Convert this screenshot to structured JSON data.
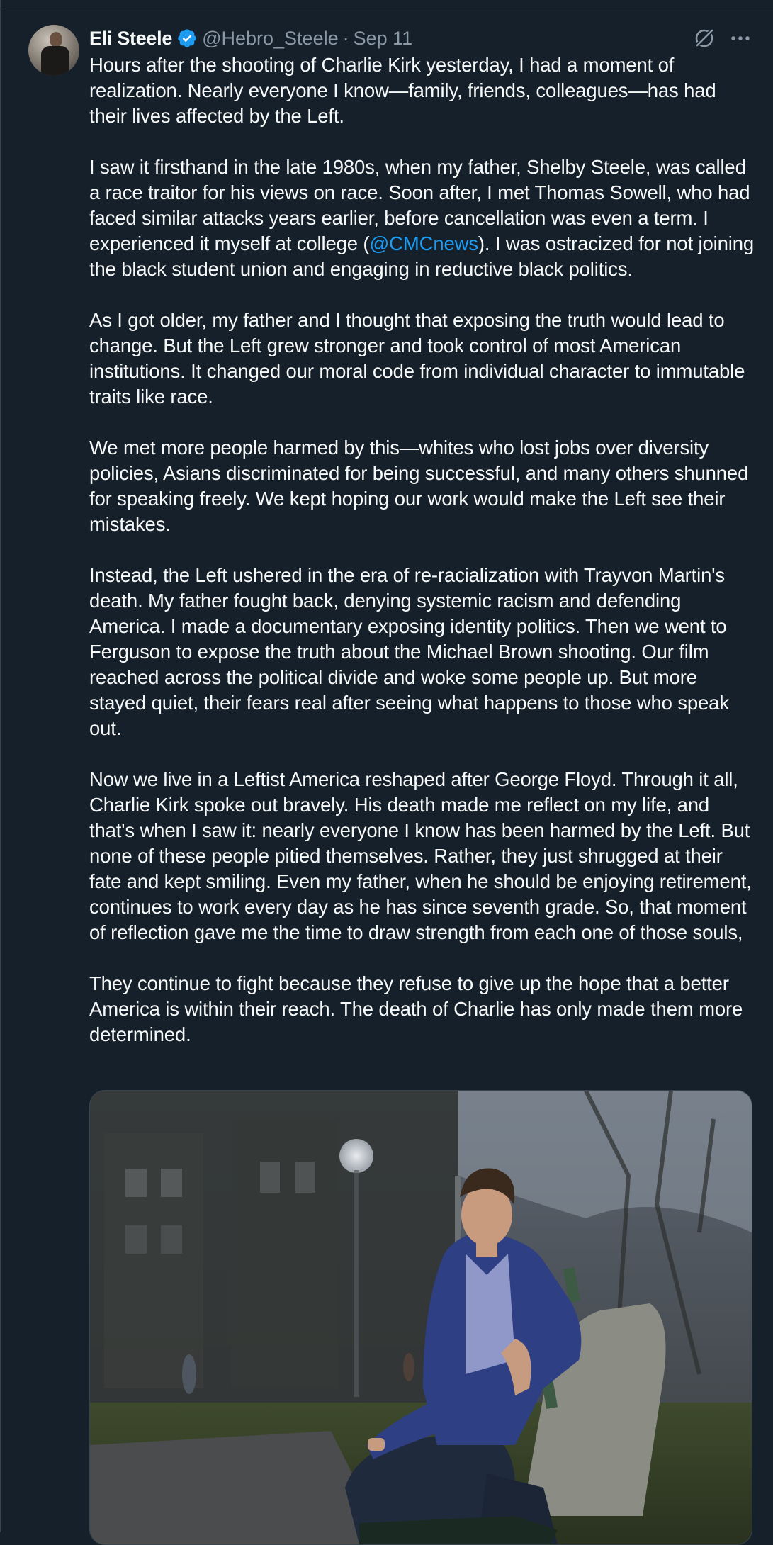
{
  "tweet": {
    "author": {
      "display_name": "Eli Steele",
      "handle": "@Hebro_Steele",
      "verified": true
    },
    "separator": "·",
    "date": "Sep 11",
    "paragraphs": [
      {
        "text": "Hours after the shooting of Charlie Kirk yesterday, I had a moment of realization. Nearly everyone I know—family, friends, colleagues—has had their lives affected by the Left."
      },
      {
        "before": "I saw it firsthand in the late 1980s, when my father, Shelby Steele, was called a race traitor for his views on race. Soon after, I met Thomas Sowell, who had faced similar attacks years earlier, before cancellation was even a term.  I experienced it myself at college (",
        "mention": "@CMCnews",
        "after": "). I was ostracized for not joining the black student union and engaging in reductive black politics."
      },
      {
        "text": "As I got older, my father and I thought that exposing the truth would lead to change. But the Left grew stronger and took control of most American institutions. It changed our moral code from individual character to immutable traits like race."
      },
      {
        "text": "We met more people harmed by this—whites who lost jobs over diversity policies, Asians discriminated for being successful, and many others shunned for speaking freely. We kept hoping our work would make the Left see their mistakes."
      },
      {
        "text": "Instead, the Left ushered in the era of re-racialization with Trayvon Martin's death. My father fought back, denying systemic racism and defending America. I made a documentary exposing identity politics. Then we went to Ferguson to expose the truth about the Michael Brown shooting. Our film reached across the political divide and woke some people up. But more stayed quiet, their fears real after seeing what happens to those who speak out."
      },
      {
        "text": "Now we live in a Leftist America reshaped after George Floyd. Through it all, Charlie Kirk spoke out bravely.  His death made me reflect on my life, and that's when I saw it: nearly everyone I know has been harmed by the Left. But none of these people pitied themselves. Rather, they just shrugged at their fate and kept smiling. Even my father, when he should be enjoying retirement, continues to work every day as he has since seventh grade. So, that moment of reflection gave me the time to draw strength from each one of those souls,"
      },
      {
        "text": "They continue to fight because they refuse to give up the hope that a better America is within their reach. The death of Charlie has only made them more determined."
      }
    ],
    "icons": {
      "verified": "verified-badge-icon",
      "grok": "grok-icon",
      "more": "more-options-icon"
    }
  },
  "colors": {
    "background": "#15202b",
    "text": "#f7f9f9",
    "secondary_text": "#8b98a5",
    "accent": "#1d9bf0",
    "border": "#38444d"
  }
}
